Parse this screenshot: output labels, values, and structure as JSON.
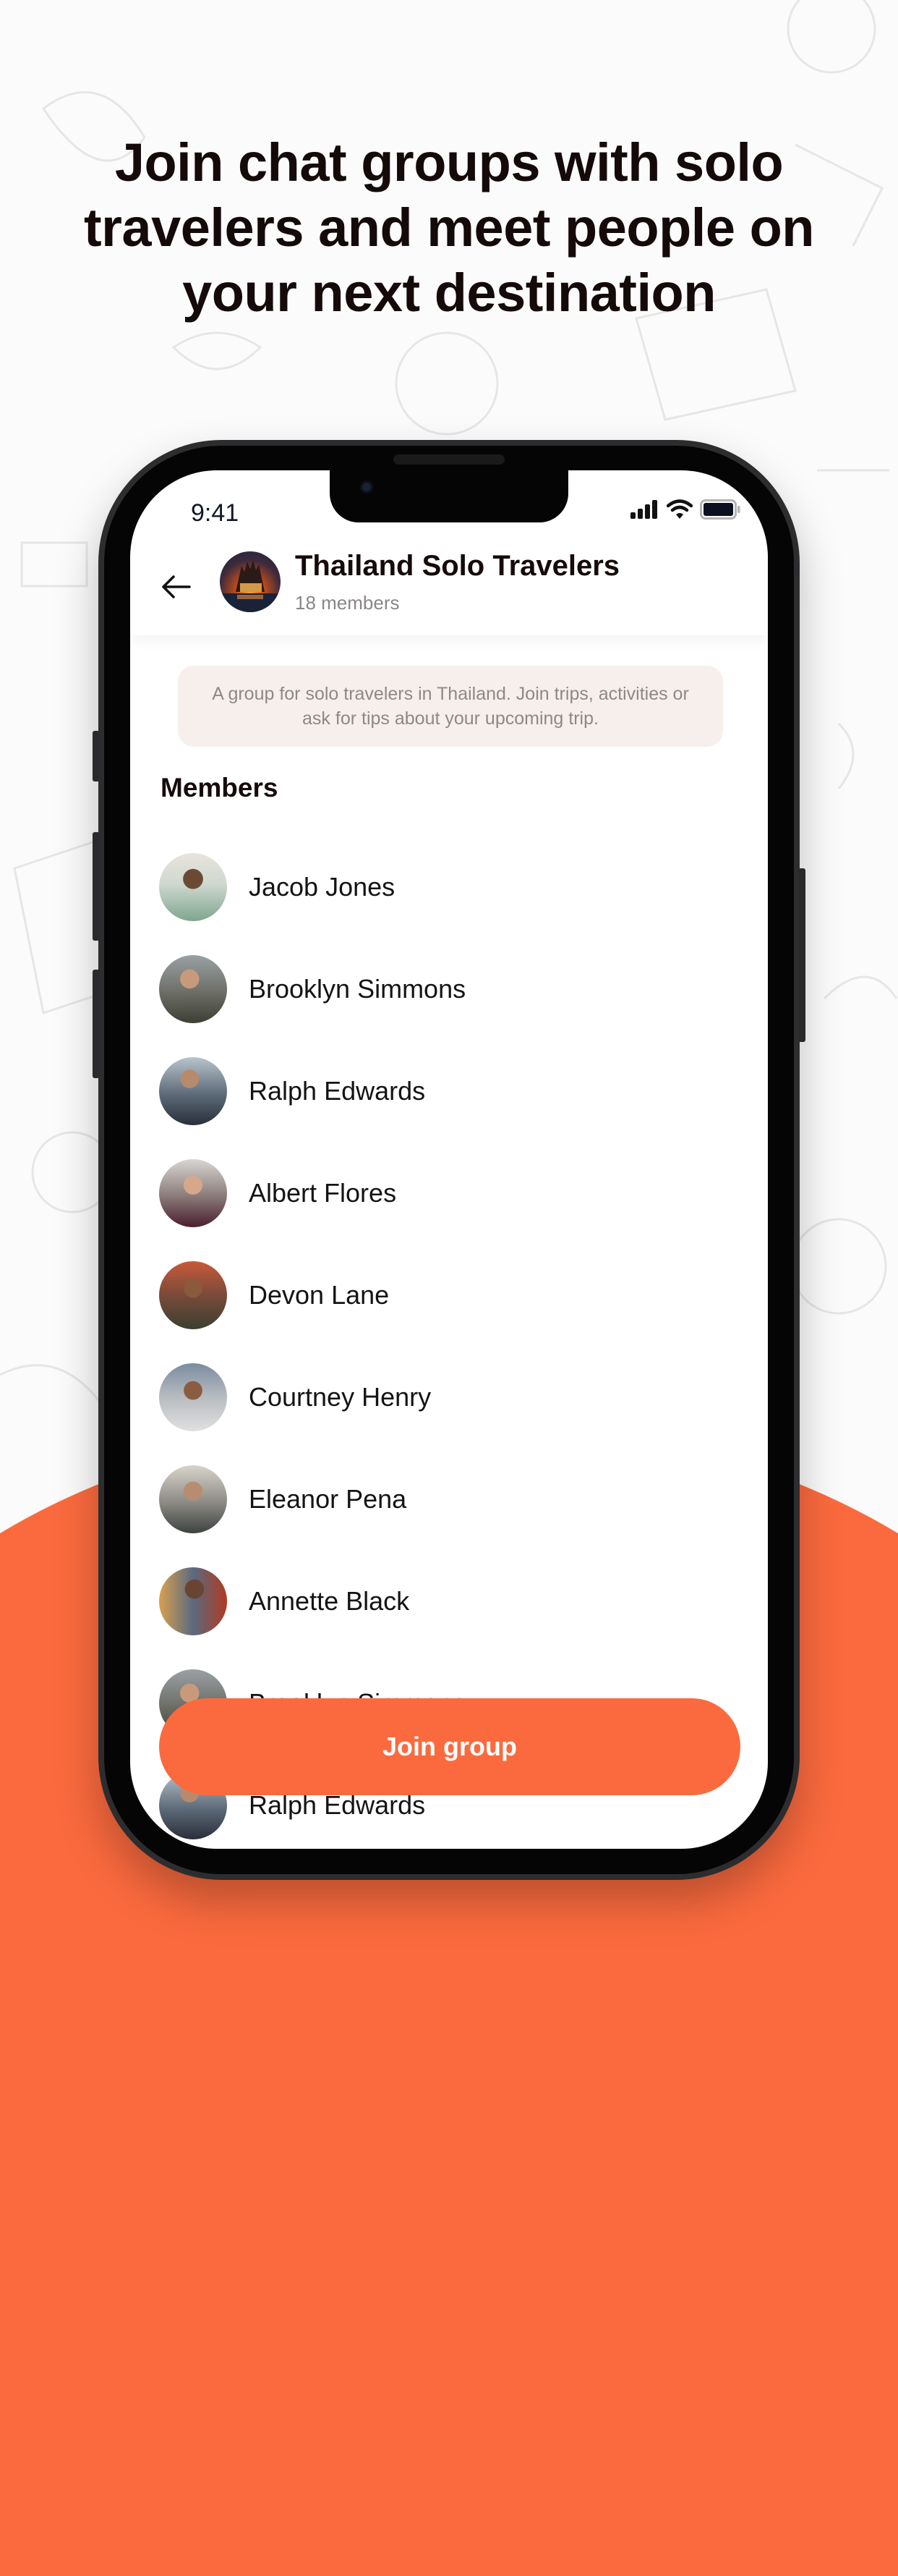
{
  "promo": {
    "headline_lines": [
      "Join chat groups with solo",
      "travelers and meet people on",
      "your next destination"
    ]
  },
  "status_bar": {
    "time": "9:41",
    "icons": [
      "signal-icon",
      "wifi-icon",
      "battery-icon"
    ]
  },
  "header": {
    "back_icon": "arrow-left-icon",
    "title": "Thailand Solo Travelers",
    "subtitle": "18 members"
  },
  "description": "A group for solo travelers in Thailand. Join trips, activities or ask for tips about your upcoming trip.",
  "members_heading": "Members",
  "members": [
    {
      "name": "Jacob Jones"
    },
    {
      "name": "Brooklyn Simmons"
    },
    {
      "name": "Ralph Edwards"
    },
    {
      "name": "Albert Flores"
    },
    {
      "name": "Devon Lane"
    },
    {
      "name": "Courtney Henry"
    },
    {
      "name": "Eleanor Pena"
    },
    {
      "name": "Annette Black"
    },
    {
      "name": "Brooklyn Simmons"
    },
    {
      "name": "Ralph Edwards"
    }
  ],
  "join_button": {
    "label": "Join group"
  },
  "colors": {
    "accent": "#fb6a3e",
    "text_dark": "#160b0b",
    "muted": "#8b8686",
    "description_bg": "#f6efec"
  }
}
